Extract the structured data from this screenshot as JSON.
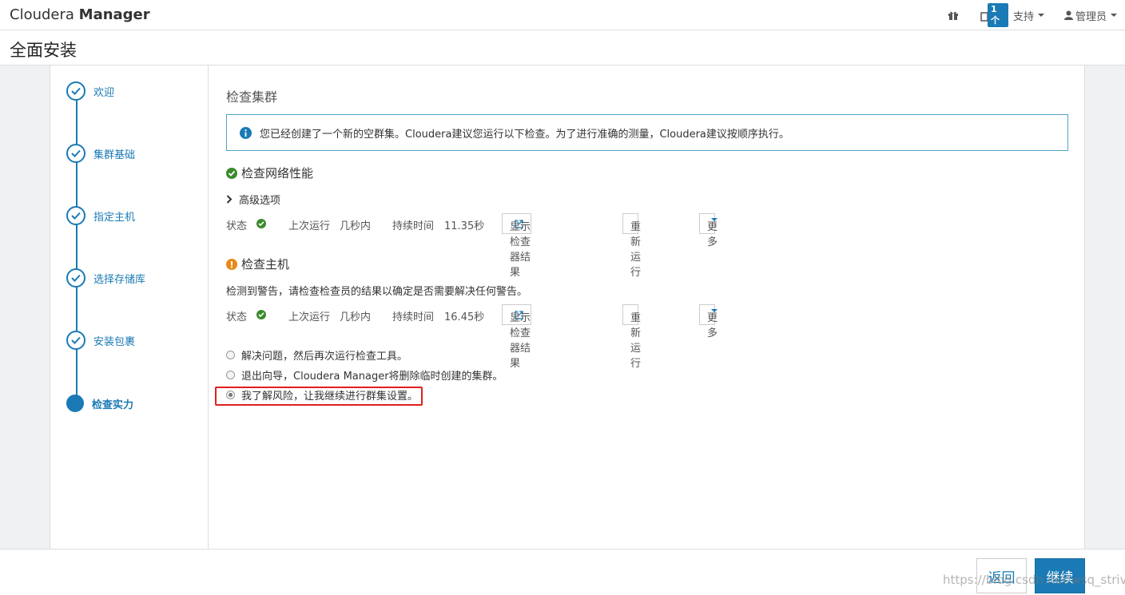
{
  "brand": {
    "name": "Cloudera",
    "bold": "Manager"
  },
  "topnav": {
    "notification_badge": "1个",
    "support_label": "支持",
    "admin_label": "管理员"
  },
  "page_title": "全面安装",
  "steps": [
    {
      "label": "欢迎",
      "state": "done"
    },
    {
      "label": "集群基础",
      "state": "done"
    },
    {
      "label": "指定主机",
      "state": "done"
    },
    {
      "label": "选择存储库",
      "state": "done"
    },
    {
      "label": "安装包裹",
      "state": "done"
    },
    {
      "label": "检查实力",
      "state": "active"
    }
  ],
  "main": {
    "section_title": "检查集群",
    "info_alert": "您已经创建了一个新的空群集。Cloudera建议您运行以下检查。为了进行准确的测量，Cloudera建议按顺序执行。",
    "network_check": {
      "title": "检查网络性能",
      "advanced_options": "高级选项",
      "status_label": "状态",
      "last_run_label": "上次运行",
      "last_run_value": "几秒内",
      "duration_label": "持续时间",
      "duration_value": "11.35秒",
      "show_results_button": "显示检查器结果",
      "rerun_button": "重新运行",
      "more_button": "更多"
    },
    "host_check": {
      "title": "检查主机",
      "description": "检测到警告，请检查检查员的结果以确定是否需要解决任何警告。",
      "status_label": "状态",
      "last_run_label": "上次运行",
      "last_run_value": "几秒内",
      "duration_label": "持续时间",
      "duration_value": "16.45秒",
      "show_results_button": "显示检查器结果",
      "rerun_button": "重新运行",
      "more_button": "更多"
    },
    "options": [
      {
        "label": "解决问题，然后再次运行检查工具。",
        "checked": false
      },
      {
        "label": "退出向导，Cloudera Manager将删除临时创建的集群。",
        "checked": false
      },
      {
        "label": "我了解风险，让我继续进行群集设置。",
        "checked": true
      }
    ]
  },
  "footer": {
    "back_button": "返回",
    "continue_button": "继续",
    "watermark": "https://blog.csdn.net/wsq_strive"
  },
  "colors": {
    "accent": "#1a7ab5",
    "success": "#3c8a2e",
    "warning": "#e8891a",
    "highlight": "#e02020"
  }
}
